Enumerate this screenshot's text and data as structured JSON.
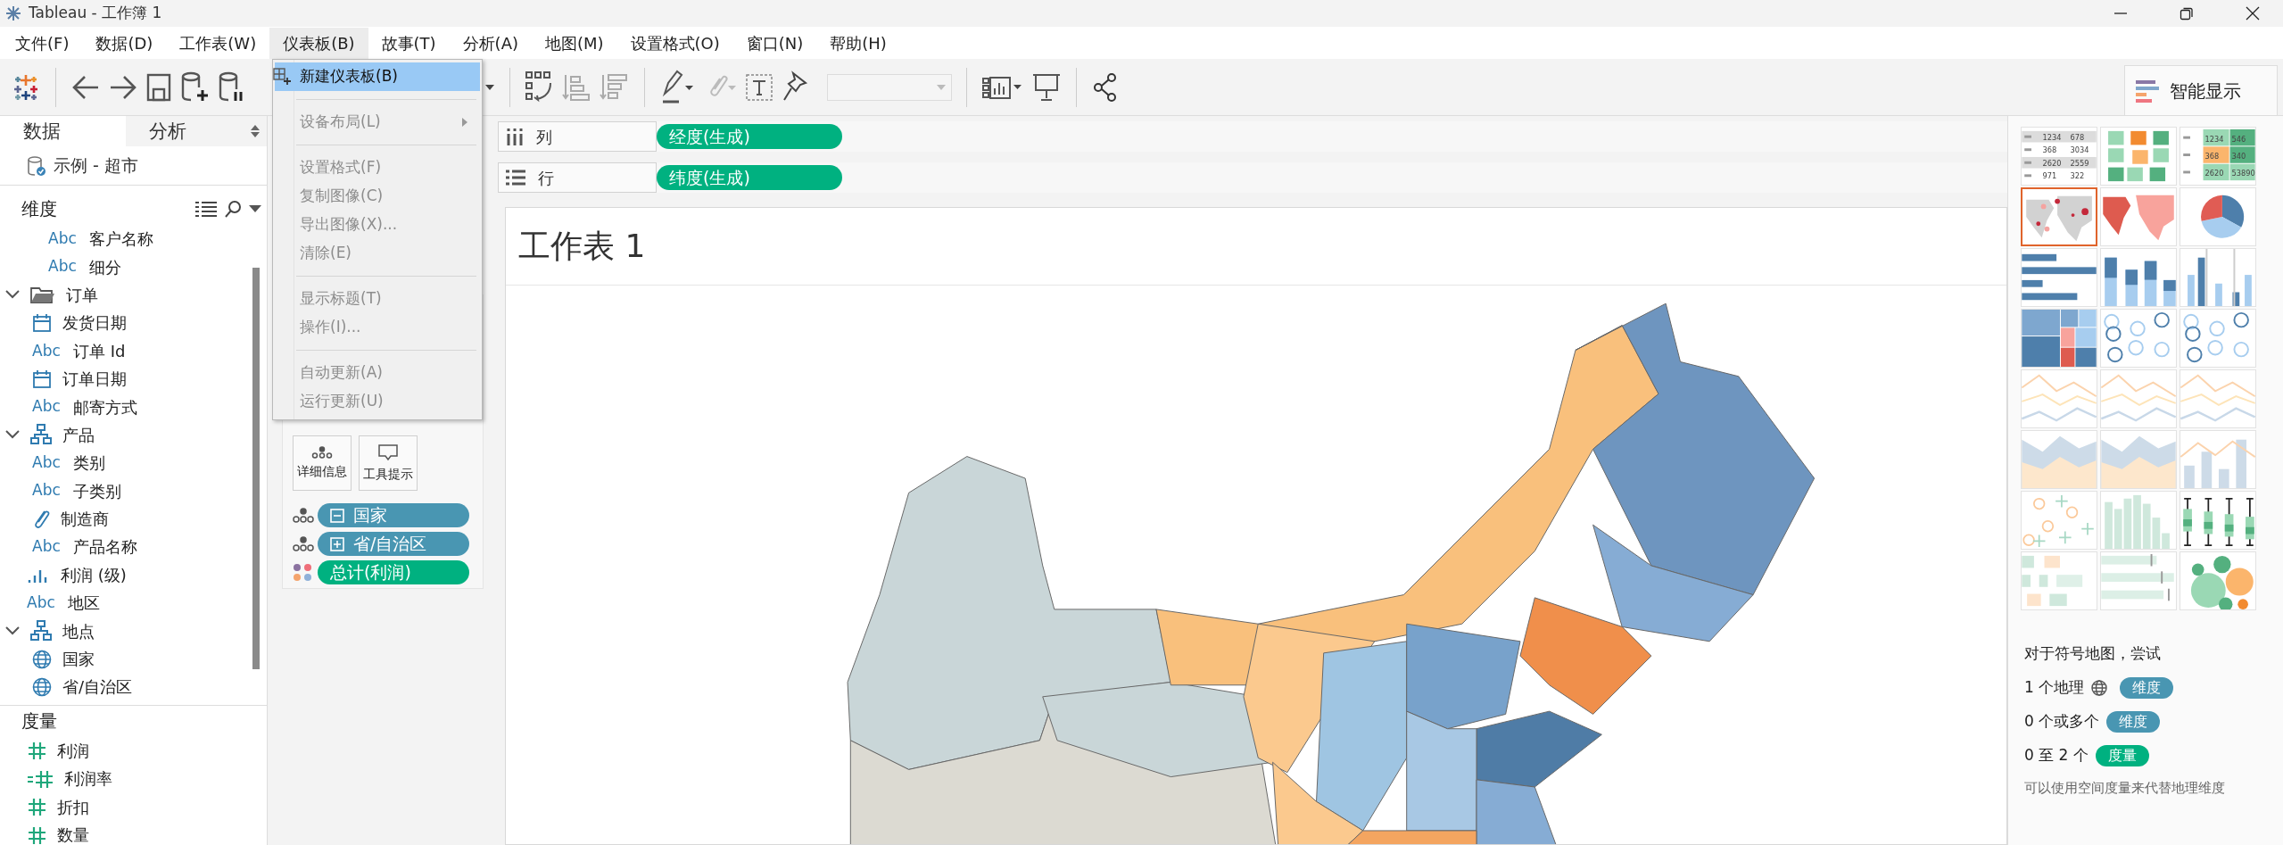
{
  "window": {
    "title": "Tableau - 工作簿 1"
  },
  "menu_bar": [
    {
      "label": "文件(F)",
      "open": false
    },
    {
      "label": "数据(D)",
      "open": false
    },
    {
      "label": "工作表(W)",
      "open": false
    },
    {
      "label": "仪表板(B)",
      "open": true
    },
    {
      "label": "故事(T)",
      "open": false
    },
    {
      "label": "分析(A)",
      "open": false
    },
    {
      "label": "地图(M)",
      "open": false
    },
    {
      "label": "设置格式(O)",
      "open": false
    },
    {
      "label": "窗口(N)",
      "open": false
    },
    {
      "label": "帮助(H)",
      "open": false
    }
  ],
  "dashboard_menu": [
    {
      "kind": "item",
      "label": "新建仪表板(B)",
      "disabled": false,
      "selected": true
    },
    {
      "kind": "separator"
    },
    {
      "kind": "submenu",
      "label": "设备布局(L)",
      "disabled": true,
      "selected": false
    },
    {
      "kind": "separator"
    },
    {
      "kind": "item",
      "label": "设置格式(F)",
      "disabled": true,
      "selected": false
    },
    {
      "kind": "item",
      "label": "复制图像(C)",
      "disabled": true,
      "selected": false
    },
    {
      "kind": "item",
      "label": "导出图像(X)...",
      "disabled": true,
      "selected": false
    },
    {
      "kind": "item",
      "label": "清除(E)",
      "disabled": true,
      "selected": false
    },
    {
      "kind": "separator"
    },
    {
      "kind": "item",
      "label": "显示标题(T)",
      "disabled": true,
      "selected": false
    },
    {
      "kind": "item",
      "label": "操作(I)...",
      "disabled": true,
      "selected": false
    },
    {
      "kind": "separator"
    },
    {
      "kind": "item",
      "label": "自动更新(A)",
      "disabled": true,
      "selected": false
    },
    {
      "kind": "item",
      "label": "运行更新(U)",
      "disabled": true,
      "selected": false
    }
  ],
  "data_pane": {
    "tabs": [
      {
        "label": "数据",
        "selected": true
      },
      {
        "label": "分析",
        "selected": false
      }
    ],
    "data_source": "示例 - 超市",
    "dimensions": {
      "title": "维度",
      "scrolled_folder_children": [
        {
          "kind": "string",
          "icon_text": "Abc",
          "label": "客户名称"
        },
        {
          "kind": "string",
          "icon_text": "Abc",
          "label": "细分"
        }
      ],
      "items": [
        {
          "kind": "folder",
          "label": "订单",
          "expanded": true,
          "children": [
            {
              "kind": "date",
              "label": "发货日期"
            },
            {
              "kind": "string",
              "icon_text": "Abc",
              "label": "订单 Id"
            },
            {
              "kind": "date",
              "label": "订单日期"
            },
            {
              "kind": "string",
              "icon_text": "Abc",
              "label": "邮寄方式"
            }
          ]
        },
        {
          "kind": "hierarchy",
          "label": "产品",
          "expanded": true,
          "children": [
            {
              "kind": "string",
              "icon_text": "Abc",
              "label": "类别"
            },
            {
              "kind": "string",
              "icon_text": "Abc",
              "label": "子类别"
            },
            {
              "kind": "attachment",
              "label": "制造商"
            },
            {
              "kind": "string",
              "icon_text": "Abc",
              "label": "产品名称"
            }
          ]
        },
        {
          "kind": "bin",
          "label": "利润 (级)"
        },
        {
          "kind": "string",
          "icon_text": "Abc",
          "label": "地区"
        },
        {
          "kind": "hierarchy",
          "label": "地点",
          "expanded": true,
          "children": [
            {
              "kind": "geo",
              "label": "国家"
            },
            {
              "kind": "geo",
              "label": "省/自治区"
            }
          ]
        }
      ]
    },
    "measures": {
      "title": "度量",
      "items": [
        {
          "kind": "measure",
          "label": "利润"
        },
        {
          "kind": "calc_measure",
          "label": "利润率"
        },
        {
          "kind": "measure",
          "label": "折扣"
        },
        {
          "kind": "measure",
          "label": "数量"
        }
      ]
    }
  },
  "marks": {
    "buttons": [
      {
        "kind": "detail",
        "label": "详细信息"
      },
      {
        "kind": "tooltip",
        "label": "工具提示"
      }
    ],
    "fields": [
      {
        "kind": "detail",
        "expanded": true,
        "color": "#4996b2",
        "label": "国家"
      },
      {
        "kind": "detail",
        "expanded": false,
        "color": "#4996b2",
        "label": "省/自治区"
      },
      {
        "kind": "color",
        "color": "#00b180",
        "label": "总计(利润)"
      }
    ]
  },
  "shelves": [
    {
      "kind": "columns",
      "label": "列",
      "pills": [
        {
          "color": "#00b180",
          "label": "经度(生成)"
        }
      ]
    },
    {
      "kind": "rows",
      "label": "行",
      "pills": [
        {
          "color": "#00b180",
          "label": "纬度(生成)"
        }
      ]
    }
  ],
  "sheet": {
    "title": "工作表 1"
  },
  "show_me": {
    "title": "智能显示",
    "chart_types": [
      {
        "kind": "text_table",
        "selected": false,
        "cells": [
          [
            "1234",
            "678"
          ],
          [
            "368",
            "3034"
          ],
          [
            "2620",
            "2559"
          ],
          [
            "971",
            "322"
          ]
        ]
      },
      {
        "kind": "heat_map",
        "selected": false
      },
      {
        "kind": "highlight_table",
        "selected": false,
        "cells": [
          [
            "1234",
            "546"
          ],
          [
            "368",
            "340"
          ],
          [
            "2620",
            "53890"
          ]
        ]
      },
      {
        "kind": "symbol_map",
        "selected": true
      },
      {
        "kind": "filled_map",
        "selected": false
      },
      {
        "kind": "pie",
        "selected": false
      },
      {
        "kind": "hbar",
        "selected": false
      },
      {
        "kind": "stacked_bar",
        "selected": false
      },
      {
        "kind": "side_bar",
        "selected": false
      },
      {
        "kind": "treemap",
        "selected": false
      },
      {
        "kind": "circle_view",
        "selected": false
      },
      {
        "kind": "side_circle",
        "selected": false
      },
      {
        "kind": "line_cont",
        "selected": false
      },
      {
        "kind": "line_disc",
        "selected": false
      },
      {
        "kind": "dual_line",
        "selected": false
      },
      {
        "kind": "area_cont",
        "selected": false
      },
      {
        "kind": "area_disc",
        "selected": false
      },
      {
        "kind": "dual_combo",
        "selected": false
      },
      {
        "kind": "scatter",
        "selected": false
      },
      {
        "kind": "histogram",
        "selected": false
      },
      {
        "kind": "box_plot",
        "selected": false
      },
      {
        "kind": "gantt",
        "selected": false
      },
      {
        "kind": "bullet",
        "selected": false
      },
      {
        "kind": "packed_bubbles",
        "selected": false
      }
    ],
    "hint": {
      "title": "对于符号地图，尝试",
      "requirements": [
        {
          "text": "1 个地理",
          "geo_icon": true,
          "color": "#4996b2",
          "pill": "维度"
        },
        {
          "text": "0 个或多个",
          "geo_icon": false,
          "color": "#4996b2",
          "pill": "维度"
        },
        {
          "text": "0 至 2 个",
          "geo_icon": false,
          "color": "#00b180",
          "pill": "度量"
        }
      ],
      "note": "可以使用空间度量来代替地理维度"
    }
  }
}
